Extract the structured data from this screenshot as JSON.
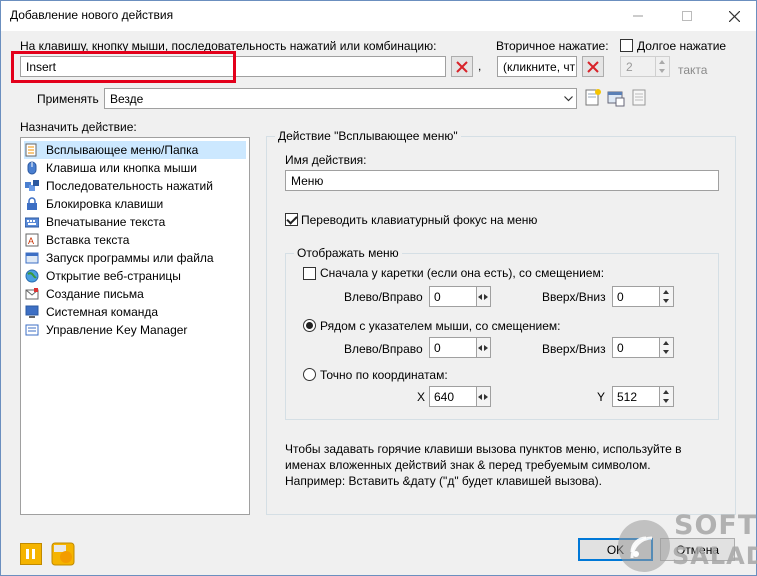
{
  "window": {
    "title": "Добавление нового действия"
  },
  "hotkey": {
    "label": "На клавишу, кнопку мыши, последовательность нажатий или комбинацию:",
    "value": "Insert",
    "separator": ",",
    "secondary_label": "Вторичное нажатие:",
    "secondary_value": "(кликните, чт",
    "long_press_label": "Долгое нажатие",
    "long_press_checked": false,
    "tact_value": "2",
    "tact_unit": "такта"
  },
  "apply": {
    "label": "Применять",
    "value": "Везде"
  },
  "assign": {
    "label": "Назначить действие:",
    "items": [
      {
        "label": "Всплывающее меню/Папка",
        "icon": "folder-menu-icon",
        "selected": true
      },
      {
        "label": "Клавиша или кнопка мыши",
        "icon": "mouse-icon",
        "selected": false
      },
      {
        "label": "Последовательность нажатий",
        "icon": "key-sequence-icon",
        "selected": false
      },
      {
        "label": "Блокировка клавиши",
        "icon": "lock-icon",
        "selected": false
      },
      {
        "label": "Впечатывание текста",
        "icon": "keyboard-icon",
        "selected": false
      },
      {
        "label": "Вставка текста",
        "icon": "paste-text-icon",
        "selected": false
      },
      {
        "label": "Запуск программы или файла",
        "icon": "run-program-icon",
        "selected": false
      },
      {
        "label": "Открытие веб-страницы",
        "icon": "globe-icon",
        "selected": false
      },
      {
        "label": "Создание письма",
        "icon": "email-icon",
        "selected": false
      },
      {
        "label": "Системная команда",
        "icon": "system-command-icon",
        "selected": false
      },
      {
        "label": "Управление Key Manager",
        "icon": "key-manager-icon",
        "selected": false
      }
    ]
  },
  "panel": {
    "title": "Действие \"Всплывающее меню\"",
    "name_label": "Имя действия:",
    "name_value": "Меню",
    "focus_label": "Переводить клавиатурный фокус на меню",
    "focus_checked": true,
    "display_group": "Отображать меню",
    "opt_caret": "Сначала у каретки (если она есть), со смещением:",
    "opt_mouse": "Рядом с указателем мыши, со смещением:",
    "opt_coords": "Точно по координатам:",
    "left_right": "Влево/Вправо",
    "up_down": "Вверх/Вниз",
    "caret_lr": "0",
    "caret_ud": "0",
    "mouse_lr": "0",
    "mouse_ud": "0",
    "x_label": "X",
    "y_label": "Y",
    "x_value": "640",
    "y_value": "512",
    "hint1": "Чтобы задавать горячие клавиши вызова пунктов меню, используйте в",
    "hint2": "именах вложенных действий знак & перед требуемым символом.",
    "hint3": "Например: Вставить &дату (\"д\" будет клавишей вызова)."
  },
  "buttons": {
    "ok": "OK",
    "cancel": "Отмена"
  },
  "watermark": {
    "line1": "SOFT",
    "line2": "SALAD"
  }
}
